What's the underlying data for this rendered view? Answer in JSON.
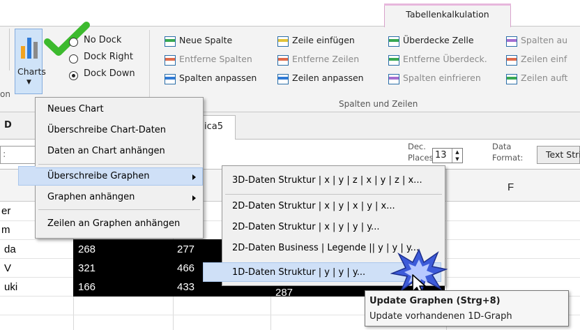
{
  "ribbon": {
    "context_tab": "Tabellenkalkulation",
    "charts_label": "Charts",
    "dock_options": [
      "No Dock",
      "Dock Right",
      "Dock Down"
    ],
    "selected_dock": "Dock Down",
    "col1": [
      "Neue Spalte",
      "Entferne Spalten",
      "Spalten anpassen"
    ],
    "col2": [
      "Zeile einfügen",
      "Entferne Zeilen",
      "Zeilen anpassen"
    ],
    "col3": [
      "Überdecke Zelle",
      "Entferne Überdeck.",
      "Spalten einfrieren"
    ],
    "col4": [
      "Spalten au",
      "Zeilen einf",
      "Zeilen auft"
    ],
    "group_caption": "Spalten und Zeilen",
    "left_cut": "on"
  },
  "tabs": {
    "left_cut": "D",
    "sheet": "ica5"
  },
  "formula": {
    "dec_label_1": "Dec.",
    "dec_label_2": "Places:",
    "dec_value": "13",
    "data_label_1": "Data",
    "data_label_2": "Format:",
    "format_value": "Text Stri",
    "left_cut": ":"
  },
  "grid": {
    "col_f": "F",
    "rows": [
      {
        "label": "er",
        "v1": "",
        "v2": "",
        "v3": ""
      },
      {
        "label": "m",
        "v1": "",
        "v2": "",
        "v3": ""
      },
      {
        "label": "da",
        "v1": "268",
        "v2": "277",
        "v3": ""
      },
      {
        "label": "V",
        "v1": "321",
        "v2": "466",
        "v3": ""
      },
      {
        "label": "uki",
        "v1": "166",
        "v2": "433",
        "v3": "287"
      }
    ]
  },
  "menu1": {
    "items": [
      "Neues Chart",
      "Überschreibe Chart-Daten",
      "Daten an Chart anhängen",
      "Überschreibe Graphen",
      "Graphen anhängen",
      "Zeilen an Graphen anhängen"
    ],
    "highlighted": "Überschreibe Graphen"
  },
  "menu2": {
    "items": [
      "3D-Daten Struktur  | x | y | z | x | y | z | x...",
      "2D-Daten Struktur  | x | y | x | y | x...",
      "2D-Daten Struktur  | x | y | y | y...",
      "2D-Daten Business  | Legende || y | y | y...",
      "1D-Daten Struktur  | y | y | y..."
    ],
    "highlighted": "1D-Daten Struktur  | y | y | y..."
  },
  "tooltip": {
    "title": "Update Graphen (Strg+8)",
    "body": "Update vorhandenen 1D-Graph"
  },
  "colors": {
    "highlight": "#cfe0f7",
    "accent_check": "#3cba2e",
    "burst": "#3d5bd9"
  }
}
